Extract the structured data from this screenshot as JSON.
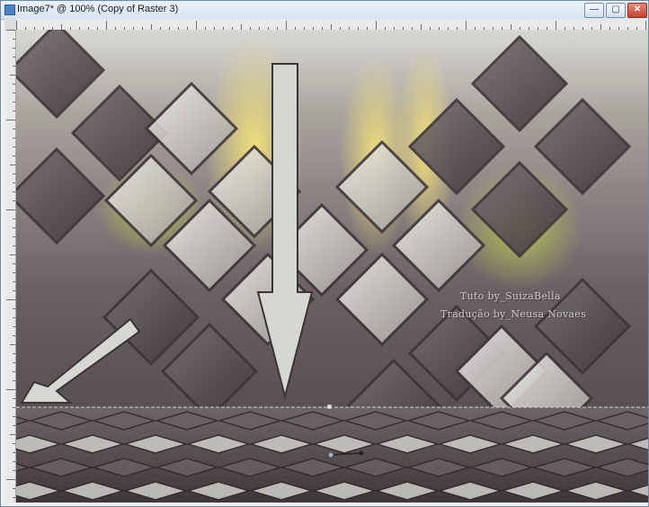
{
  "window": {
    "title": "Image7* @ 100% (Copy of Raster 3)",
    "controls": {
      "minimize": "—",
      "maximize": "▢",
      "close": "✕"
    }
  },
  "canvas": {
    "watermark_line1": "Tuto by_SuizaBella",
    "watermark_line2": "Tradução by_Neusa Novaes",
    "colors": {
      "background": "#5b5458",
      "tile_light": "#d8d8d4",
      "tile_dark": "#5a5055",
      "arrow": "#d6d6d2",
      "glow_yellow": "#e8d76a",
      "glow_green": "#a9b84a"
    }
  },
  "icons": {
    "app": "image-icon",
    "minimize": "minimize-icon",
    "maximize": "maximize-icon",
    "close": "close-icon"
  }
}
